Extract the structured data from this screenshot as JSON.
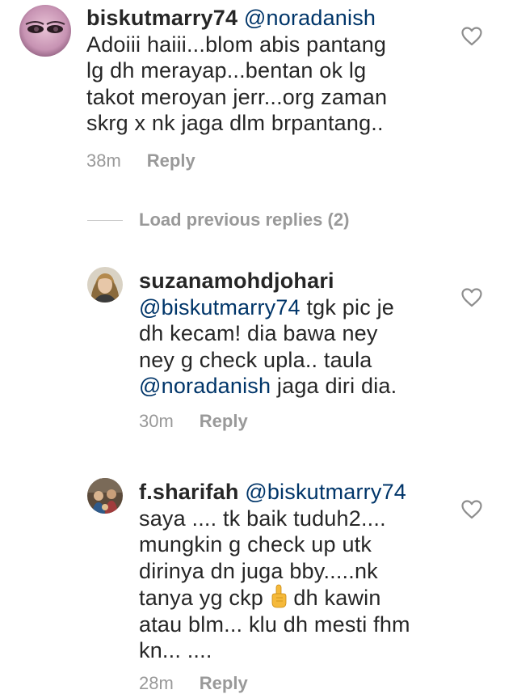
{
  "comments": [
    {
      "username": "biskutmarry74",
      "mention": "@noradanish",
      "lines": [
        "Adoiii haiii...blom abis pantang",
        "lg dh merayap...bentan ok lg",
        "takot meroyan jerr...org zaman",
        "skrg x nk jaga dlm brpantang.."
      ],
      "time": "38m",
      "reply_label": "Reply"
    }
  ],
  "load_previous": {
    "label": "Load previous replies (2)"
  },
  "replies": [
    {
      "username": "suzanamohdjohari",
      "mention1": "@biskutmarry74",
      "text1": " tgk pic je",
      "line2": "dh kecam! dia bawa ney",
      "line3": "ney g check upla.. taula",
      "mention2": "@noradanish",
      "text4": " jaga diri dia.",
      "time": "30m",
      "reply_label": "Reply"
    },
    {
      "username": "f.sharifah",
      "mention": "@biskutmarry74",
      "line1": "saya .... tk baik tuduh2....",
      "line2": "mungkin g check up utk",
      "line3": "dirinya dn juga bby.....nk",
      "line4_pre": "tanya yg ckp ",
      "line4_post": "  dh kawin",
      "line5": "atau blm... klu dh mesti fhm",
      "line6": "kn... ....",
      "time": "28m",
      "reply_label": "Reply"
    }
  ],
  "icons": {
    "like": "heart-outline-icon",
    "emoji": "pointing-up-hand-emoji"
  },
  "colors": {
    "text": "#262626",
    "mention": "#003569",
    "meta": "#999999"
  }
}
